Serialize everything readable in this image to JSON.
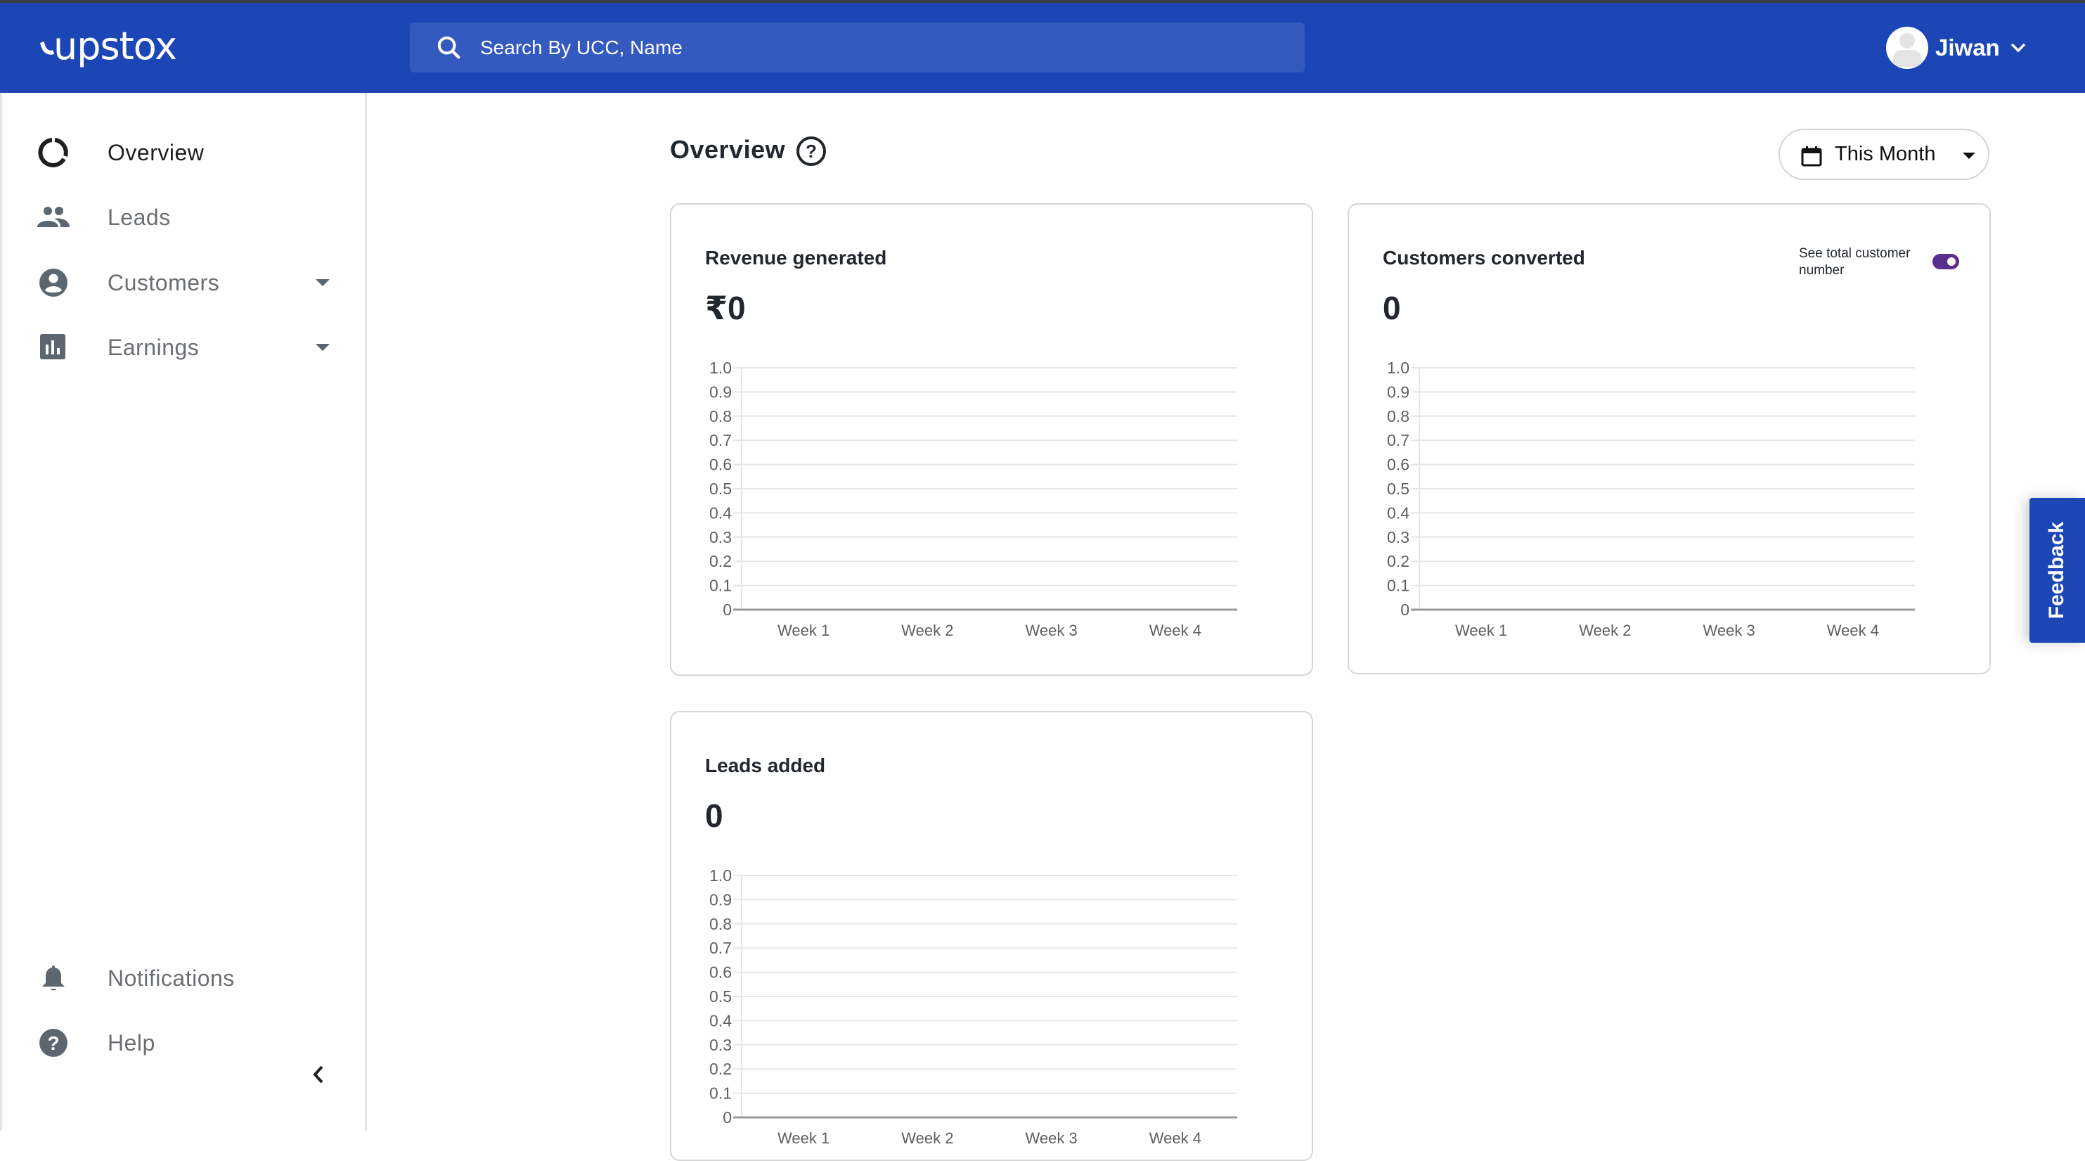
{
  "header": {
    "logo_text": "upstox",
    "search_placeholder": "Search By UCC, Name",
    "search_value": "",
    "user_name": "Jiwan",
    "colors": {
      "brand": "#1c46b5",
      "search_bg": "#3459bf"
    }
  },
  "sidebar": {
    "items": [
      {
        "label": "Overview",
        "icon": "donut-icon",
        "active": true,
        "expandable": false
      },
      {
        "label": "Leads",
        "icon": "people-icon",
        "active": false,
        "expandable": false
      },
      {
        "label": "Customers",
        "icon": "account-circle-icon",
        "active": false,
        "expandable": true
      },
      {
        "label": "Earnings",
        "icon": "bar-chart-icon",
        "active": false,
        "expandable": true
      }
    ],
    "bottom_items": [
      {
        "label": "Notifications",
        "icon": "bell-icon"
      },
      {
        "label": "Help",
        "icon": "help-circle-icon"
      }
    ],
    "collapse_icon": "chevron-left-icon"
  },
  "main": {
    "title": "Overview",
    "help_glyph": "?",
    "period_selector": {
      "label": "This Month",
      "icon": "calendar-icon"
    },
    "cards": [
      {
        "title": "Revenue generated",
        "value": "₹0"
      },
      {
        "title": "Customers converted",
        "value": "0",
        "toggle": {
          "label": "See total customer number",
          "on": true,
          "color": "#5b2d8e"
        }
      },
      {
        "title": "Leads added",
        "value": "0"
      }
    ]
  },
  "feedback": {
    "label": "Feedback"
  },
  "chart_data": [
    {
      "type": "bar",
      "title": "Revenue generated",
      "categories": [
        "Week 1",
        "Week 2",
        "Week 3",
        "Week 4"
      ],
      "values": [
        0,
        0,
        0,
        0
      ],
      "yticks": [
        "0",
        "0.1",
        "0.2",
        "0.3",
        "0.4",
        "0.5",
        "0.6",
        "0.7",
        "0.8",
        "0.9",
        "1.0"
      ],
      "ylim": [
        0,
        1
      ],
      "xlabel": "",
      "ylabel": "",
      "grid": true
    },
    {
      "type": "bar",
      "title": "Customers converted",
      "categories": [
        "Week 1",
        "Week 2",
        "Week 3",
        "Week 4"
      ],
      "values": [
        0,
        0,
        0,
        0
      ],
      "yticks": [
        "0",
        "0.1",
        "0.2",
        "0.3",
        "0.4",
        "0.5",
        "0.6",
        "0.7",
        "0.8",
        "0.9",
        "1.0"
      ],
      "ylim": [
        0,
        1
      ],
      "xlabel": "",
      "ylabel": "",
      "grid": true
    },
    {
      "type": "bar",
      "title": "Leads added",
      "categories": [
        "Week 1",
        "Week 2",
        "Week 3",
        "Week 4"
      ],
      "values": [
        0,
        0,
        0,
        0
      ],
      "yticks": [
        "0",
        "0.1",
        "0.2",
        "0.3",
        "0.4",
        "0.5",
        "0.6",
        "0.7",
        "0.8",
        "0.9",
        "1.0"
      ],
      "ylim": [
        0,
        1
      ],
      "xlabel": "",
      "ylabel": "",
      "grid": true
    }
  ]
}
